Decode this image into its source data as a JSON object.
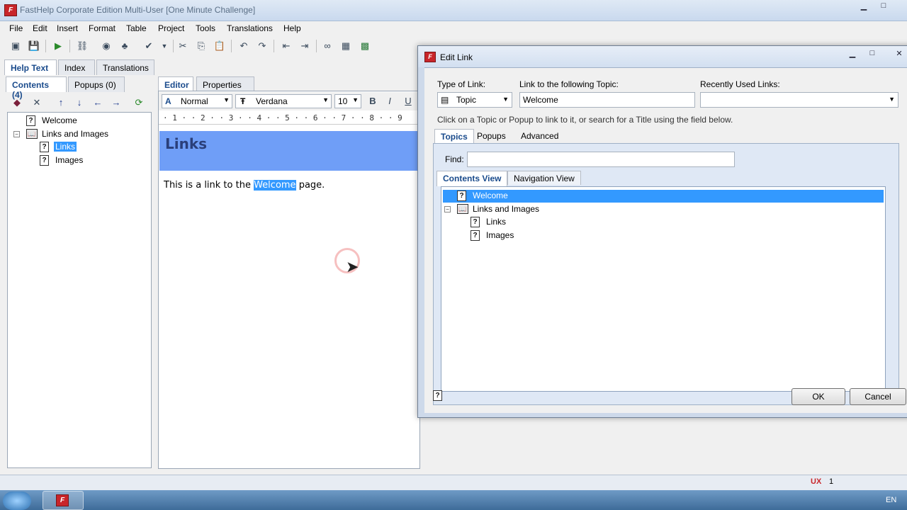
{
  "window": {
    "title": "FastHelp Corporate Edition Multi-User [One Minute Challenge]",
    "app_icon_text": "F",
    "min": "▁",
    "max": "□",
    "close": "✕"
  },
  "menu": [
    "File",
    "Edit",
    "Insert",
    "Format",
    "Table",
    "Project",
    "Tools",
    "Translations",
    "Help"
  ],
  "left_tabs": [
    "Help Text",
    "Index",
    "Translations"
  ],
  "left_subtabs": [
    "Contents (4)",
    "Popups (0)"
  ],
  "contents_tree": [
    {
      "label": "Welcome"
    },
    {
      "label": "Links and Images",
      "expander": "−"
    },
    {
      "label": "Links"
    },
    {
      "label": "Images"
    }
  ],
  "editor_tabs": [
    "Editor",
    "Properties"
  ],
  "format_bar": {
    "style": "Normal",
    "font": "Verdana",
    "size": "10",
    "bold": "B",
    "italic": "I",
    "underline": "U"
  },
  "ruler": "· 1 · · 2 · · 3 · · 4 · · 5 · · 6 · · 7 · · 8 · · 9",
  "document": {
    "heading": "Links",
    "text_before": "This is a link to the ",
    "link_text": "Welcome",
    "text_after": " page."
  },
  "dialog": {
    "title": "Edit Link",
    "type_label": "Type of Link:",
    "type_value": "Topic",
    "link_label": "Link to the following Topic:",
    "link_value": "Welcome",
    "recent_label": "Recently Used Links:",
    "instruction": "Click on a Topic or Popup to link to it, or search for a Title using the field below.",
    "tabs": [
      "Topics",
      "Popups",
      "Advanced"
    ],
    "find_label": "Find:",
    "view_tabs": [
      "Contents View",
      "Navigation View"
    ],
    "tree": [
      {
        "label": "Welcome"
      },
      {
        "label": "Links and Images",
        "expander": "−"
      },
      {
        "label": "Links"
      },
      {
        "label": "Images"
      }
    ],
    "ok": "OK",
    "cancel": "Cancel",
    "help_icon_text": "?"
  },
  "status": {
    "indicator": "1"
  },
  "taskbar": {
    "lang": "EN"
  },
  "colors": {
    "selection": "#3399ff",
    "heading_band": "#6f9ef7",
    "accent": "#1a4b8c"
  }
}
